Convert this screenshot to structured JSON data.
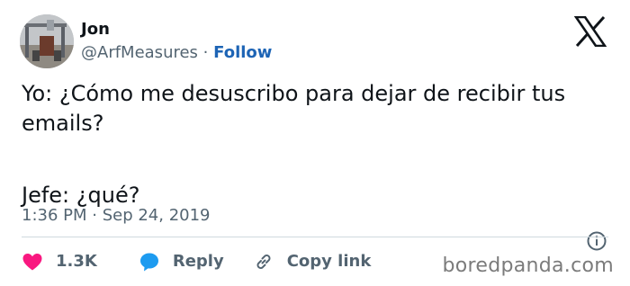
{
  "user": {
    "name": "Jon",
    "handle": "@ArfMeasures",
    "separator": "·",
    "follow_label": "Follow"
  },
  "tweet": {
    "lines": [
      "Yo: ¿Cómo me desuscribo para dejar de recibir tus",
      "emails?",
      "Jefe: ¿qué?"
    ],
    "timestamp": "1:36 PM · Sep 24, 2019"
  },
  "actions": {
    "likes_count": "1.3K",
    "reply_label": "Reply",
    "copy_link_label": "Copy link"
  },
  "watermark": "boredpanda.com",
  "icons": {
    "platform": "x-logo-icon",
    "like": "heart-icon",
    "reply": "speech-bubble-icon",
    "copy": "link-icon",
    "info": "info-icon"
  },
  "colors": {
    "text": "#0f1419",
    "secondary": "#536471",
    "follow": "#1d64b5",
    "heart": "#f91880",
    "reply_bubble": "#1d9bf0",
    "divider": "#cfd9de"
  }
}
